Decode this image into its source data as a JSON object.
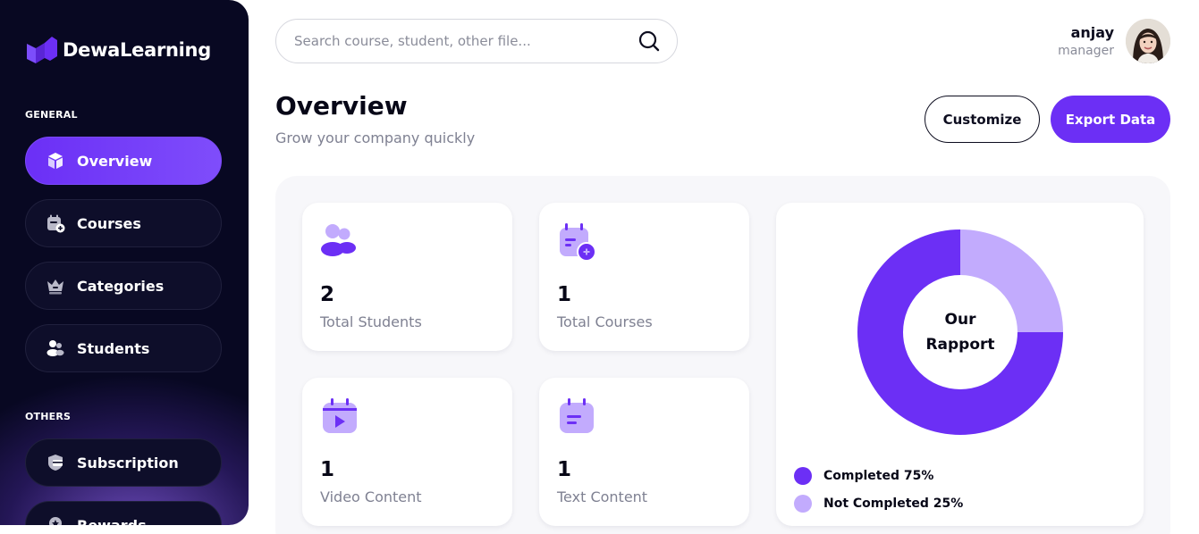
{
  "brand": {
    "name": "DewaLearning"
  },
  "colors": {
    "accent": "#6c2ff5",
    "accent_light": "#c2abfd",
    "sidebar_bg": "#080822"
  },
  "sidebar": {
    "general_label": "GENERAL",
    "others_label": "OTHERS",
    "items": [
      {
        "label": "Overview",
        "icon": "cube-icon",
        "active": true
      },
      {
        "label": "Courses",
        "icon": "calendar-add-icon",
        "active": false
      },
      {
        "label": "Categories",
        "icon": "crown-icon",
        "active": false
      },
      {
        "label": "Students",
        "icon": "users-icon",
        "active": false
      },
      {
        "label": "Subscription",
        "icon": "card-icon",
        "active": false
      },
      {
        "label": "Rewards",
        "icon": "medal-icon",
        "active": false
      }
    ]
  },
  "search": {
    "placeholder": "Search course, student, other file...",
    "value": ""
  },
  "user": {
    "name": "anjay",
    "role": "manager"
  },
  "header": {
    "title": "Overview",
    "subtitle": "Grow your company quickly",
    "customize_label": "Customize",
    "export_label": "Export Data"
  },
  "stats": [
    {
      "value": "2",
      "label": "Total Students",
      "icon": "users-icon"
    },
    {
      "value": "1",
      "label": "Total Courses",
      "icon": "calendar-add-icon"
    },
    {
      "value": "1",
      "label": "Video Content",
      "icon": "video-calendar-icon"
    },
    {
      "value": "1",
      "label": "Text Content",
      "icon": "document-calendar-icon"
    }
  ],
  "chart_data": {
    "type": "pie",
    "title": "Our Rapport",
    "categories": [
      "Completed",
      "Not Completed"
    ],
    "values": [
      75,
      25
    ],
    "colors": [
      "#6c2ff5",
      "#c2abfd"
    ],
    "legend": [
      "Completed 75%",
      "Not Completed 25%"
    ],
    "legend_position": "bottom-left"
  }
}
